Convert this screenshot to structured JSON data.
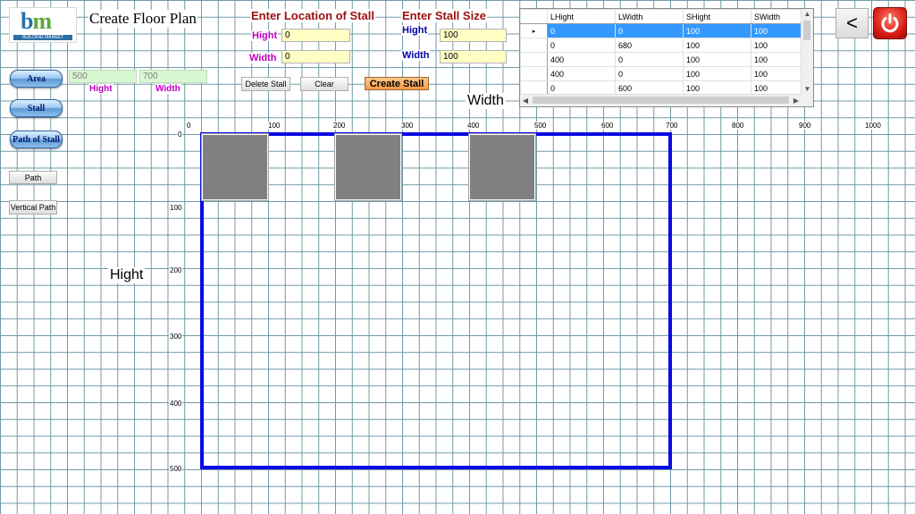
{
  "app": {
    "title": "Create Floor Plan",
    "logo_text": "BUILDING MARKET",
    "logo_mark_b": "b",
    "logo_mark_m": "m"
  },
  "location": {
    "title": "Enter Location of Stall",
    "hight_label": "Hight",
    "hight_value": "0",
    "width_label": "Width",
    "width_value": "0"
  },
  "size": {
    "title": "Enter Stall Size",
    "hight_label": "Hight",
    "hight_value": "100",
    "width_label": "Width",
    "width_value": "100"
  },
  "area": {
    "hight_value": "500",
    "width_value": "700",
    "hight_label": "Hight",
    "width_label": "Width"
  },
  "sidebar": {
    "area_label": "Area",
    "stall_label": "Stall",
    "path_of_stall_label": "Path of Stall",
    "path_label": "Path",
    "vertical_path_label": "Vertical Path"
  },
  "toolbar": {
    "delete_label": "Delete Stall",
    "clear_label": "Clear",
    "create_label": "Create Stall"
  },
  "grid": {
    "columns": [
      "LHight",
      "LWidth",
      "SHight",
      "SWidth"
    ],
    "rows": [
      [
        "0",
        "0",
        "100",
        "100"
      ],
      [
        "0",
        "680",
        "100",
        "100"
      ],
      [
        "400",
        "0",
        "100",
        "100"
      ],
      [
        "400",
        "0",
        "100",
        "100"
      ],
      [
        "0",
        "600",
        "100",
        "100"
      ]
    ],
    "selected_row": 0,
    "row_indicator": "▸"
  },
  "nav": {
    "back_label": "<"
  },
  "canvas": {
    "width_label": "Width",
    "hight_label": "Hight",
    "x_ticks": [
      "0",
      "100",
      "200",
      "300",
      "400",
      "500",
      "600",
      "700",
      "800",
      "900",
      "1000"
    ],
    "y_ticks": [
      "0",
      "100",
      "200",
      "300",
      "400",
      "500"
    ],
    "area_color": "#0a0ae6",
    "stall_color": "#808080",
    "stalls": [
      {
        "l_hight": 0,
        "l_width": 0,
        "s_hight": 100,
        "s_width": 100
      },
      {
        "l_hight": 0,
        "l_width": 200,
        "s_hight": 100,
        "s_width": 100
      },
      {
        "l_hight": 0,
        "l_width": 400,
        "s_hight": 100,
        "s_width": 100
      }
    ]
  }
}
